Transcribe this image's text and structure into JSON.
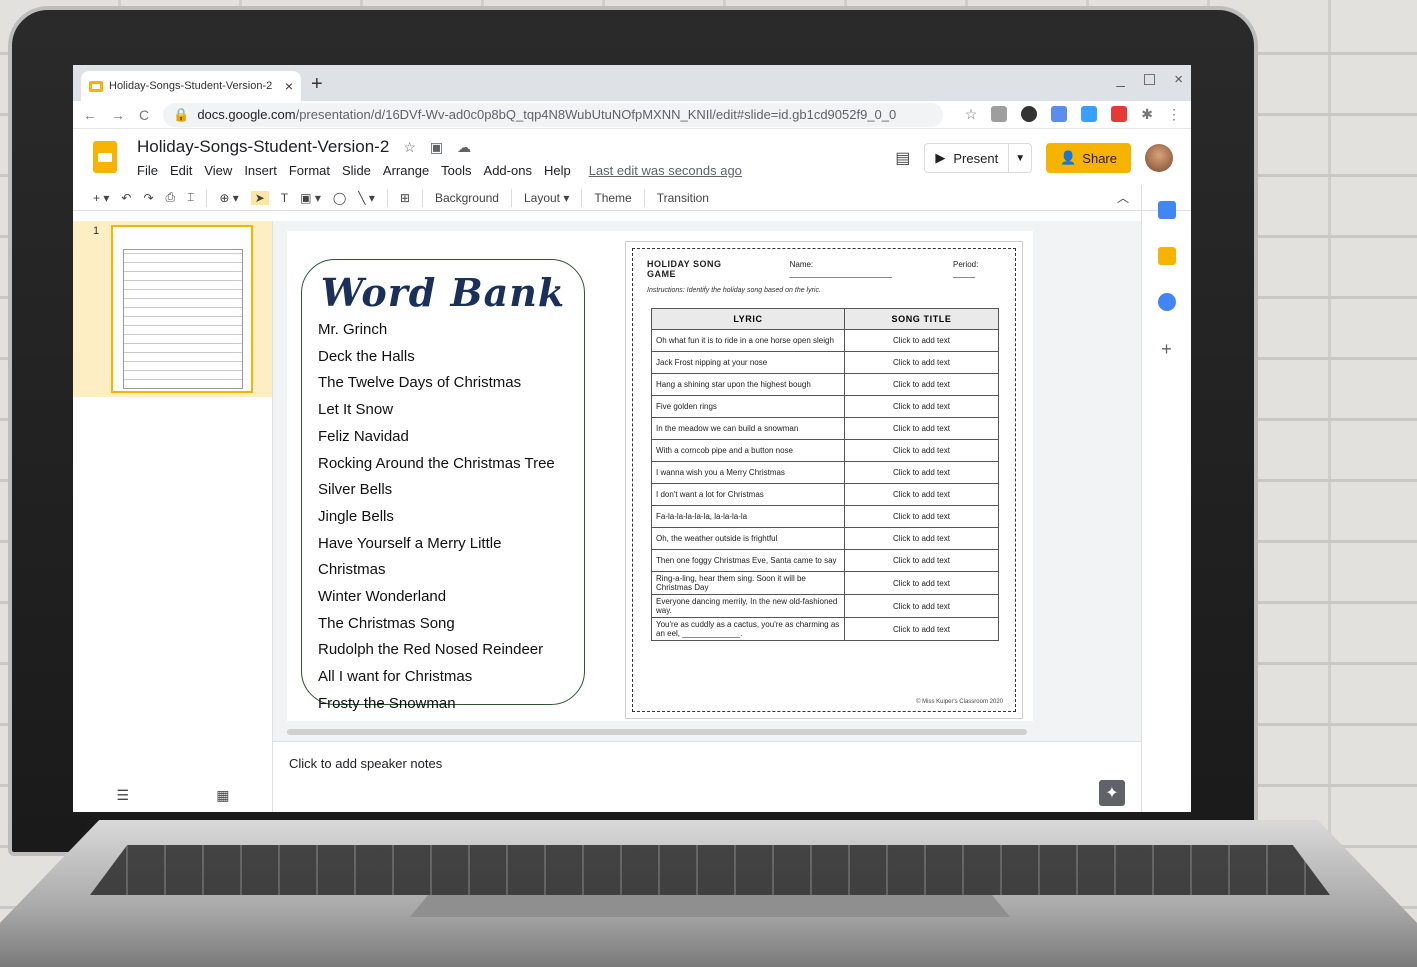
{
  "browser": {
    "tab_title": "Holiday-Songs-Student-Version-2",
    "tab_close": "×",
    "new_tab": "+",
    "window_controls": [
      "_",
      "☐",
      "×"
    ],
    "url_domain": "docs.google.com",
    "url_path": "/presentation/d/16DVf-Wv-ad0c0p8bQ_tqp4N8WubUtuNOfpMXNN_KNIl/edit#slide=id.gb1cd9052f9_0_0"
  },
  "app": {
    "doc_title": "Holiday-Songs-Student-Version-2",
    "menu": [
      "File",
      "Edit",
      "View",
      "Insert",
      "Format",
      "Slide",
      "Arrange",
      "Tools",
      "Add-ons",
      "Help"
    ],
    "last_edit": "Last edit was seconds ago",
    "present_label": "Present",
    "share_label": "Share"
  },
  "toolbar": {
    "background": "Background",
    "layout": "Layout",
    "theme": "Theme",
    "transition": "Transition"
  },
  "filmstrip": {
    "slide_number": "1"
  },
  "slide": {
    "word_bank": {
      "title": "Word Bank",
      "items": [
        "Mr. Grinch",
        "Deck the Halls",
        "The Twelve Days of Christmas",
        "Let It Snow",
        "Feliz Navidad",
        "Rocking Around the Christmas Tree",
        "Silver Bells",
        "Jingle Bells",
        "Have Yourself a Merry Little Christmas",
        "Winter Wonderland",
        "The Christmas Song",
        "Rudolph the Red Nosed Reindeer",
        "All I want for Christmas",
        "Frosty the Snowman"
      ]
    },
    "worksheet": {
      "title": "HOLIDAY SONG GAME",
      "name_label": "Name: _______________________",
      "period_label": "Period: _____",
      "instructions": "Instructions: Identify the holiday song based on the lyric.",
      "col_lyric": "LYRIC",
      "col_title": "SONG TITLE",
      "placeholder": "Click to add text",
      "lyrics": [
        "Oh what fun it is to ride in a one horse open sleigh",
        "Jack Frost nipping at your nose",
        "Hang a shining star upon the highest bough",
        "Five golden rings",
        "In the meadow we can build a snowman",
        "With a corncob pipe and a button nose",
        "I wanna wish you a Merry Christmas",
        "I don't want a lot for Christmas",
        "Fa-la-la-la-la-la, la-la-la-la",
        "Oh, the weather outside is frightful",
        "Then one foggy Christmas Eve, Santa came to say",
        "Ring-a-ling, hear them sing. Soon it will be Christmas Day",
        "Everyone dancing merrily, In the new old-fashioned way.",
        "You're as cuddly as a cactus, you're as charming as an eel, _____________."
      ],
      "footer": "© Miss Kuiper's Classroom 2020"
    }
  },
  "notes": {
    "placeholder": "Click to add speaker notes"
  },
  "colors": {
    "accent": "#f6b400",
    "wordbank_border": "#2c5530",
    "wordbank_title": "#1a2f5a"
  }
}
